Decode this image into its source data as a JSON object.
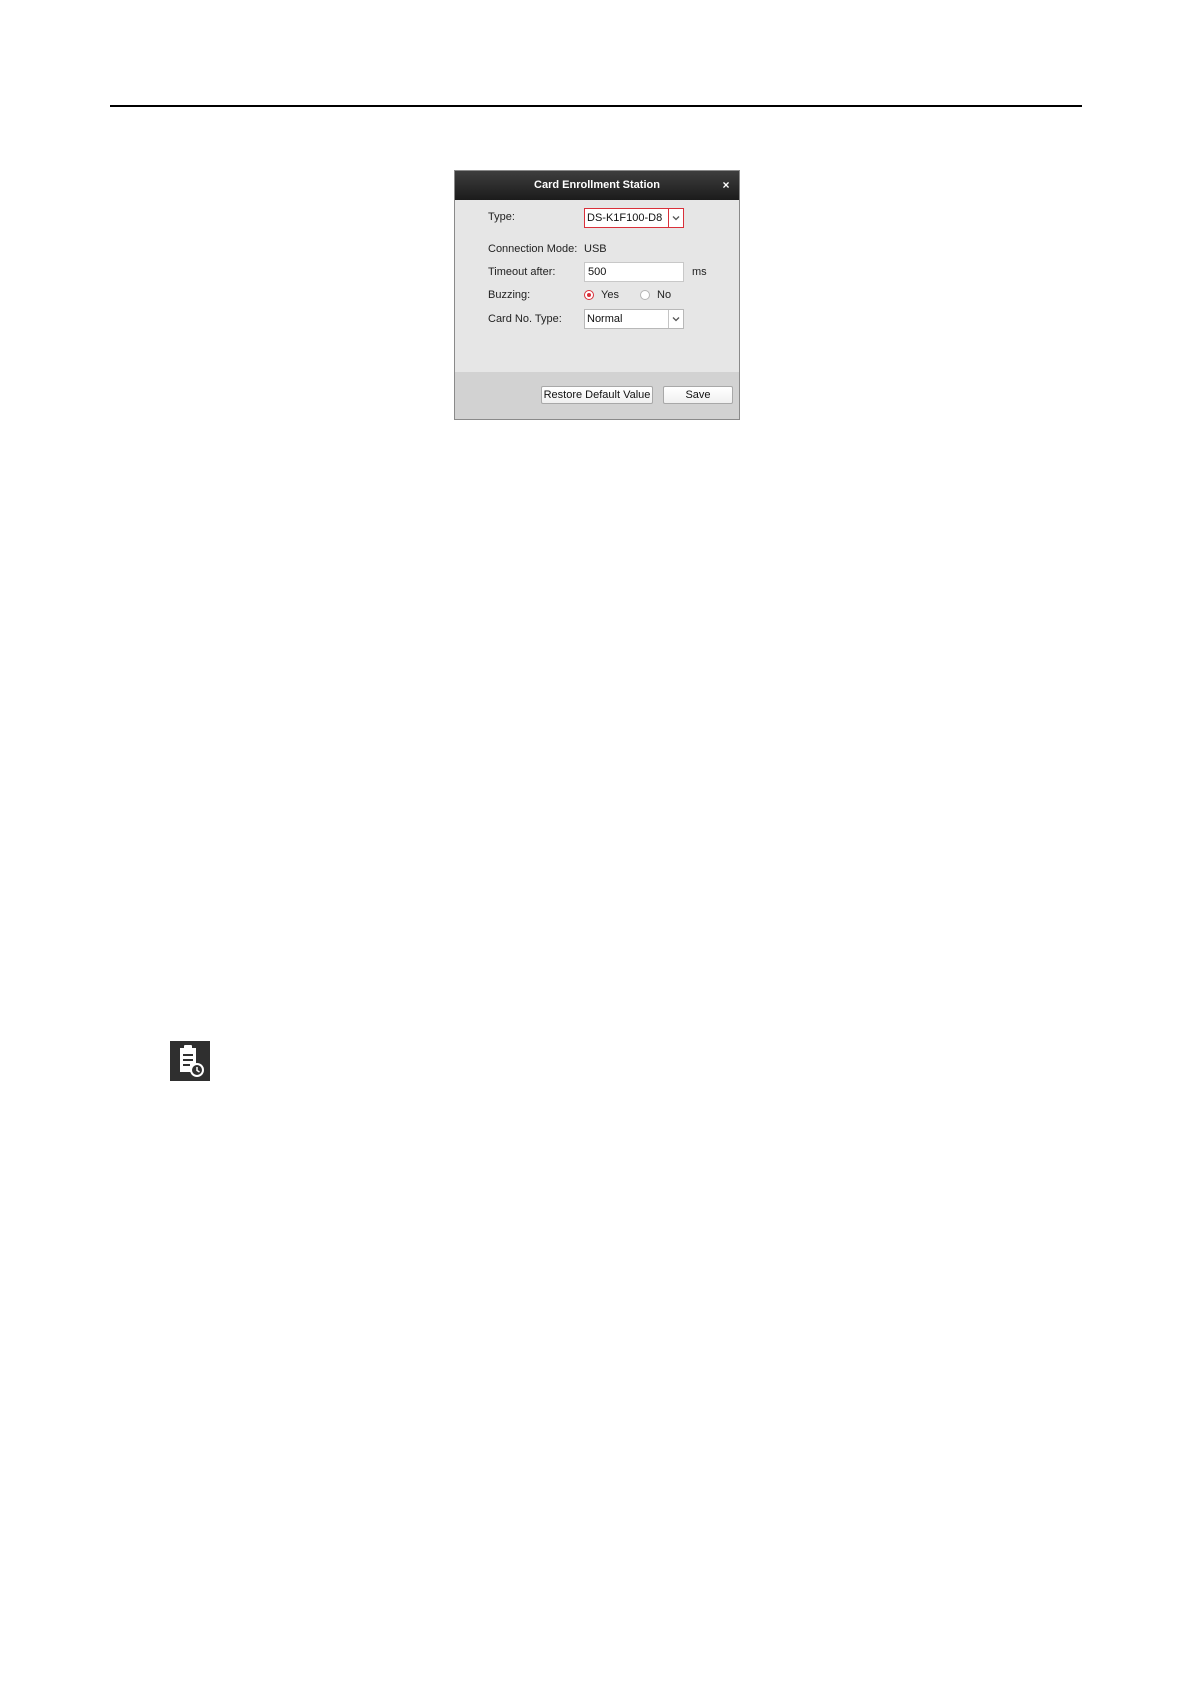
{
  "dialog": {
    "title": "Card Enrollment Station",
    "close_glyph": "×",
    "type": {
      "label": "Type:",
      "selected": "DS-K1F100-D8"
    },
    "connection_mode": {
      "label": "Connection Mode:",
      "value": "USB"
    },
    "timeout": {
      "label": "Timeout after:",
      "value": "500",
      "unit": "ms"
    },
    "buzzing": {
      "label": "Buzzing:",
      "options": [
        {
          "label": "Yes",
          "checked": true
        },
        {
          "label": "No",
          "checked": false
        }
      ]
    },
    "card_no_type": {
      "label": "Card No. Type:",
      "selected": "Normal"
    },
    "buttons": {
      "restore_label": "Restore Default Value",
      "save_label": "Save"
    }
  },
  "icons": {
    "note": "note-clipboard-clock-icon"
  },
  "colors": {
    "accent": "#d9303a",
    "titlebar": "#2a2a2a",
    "dialog_bg": "#e6e6e6",
    "footer_bg": "#d2d2d2",
    "rule": "#000000"
  }
}
